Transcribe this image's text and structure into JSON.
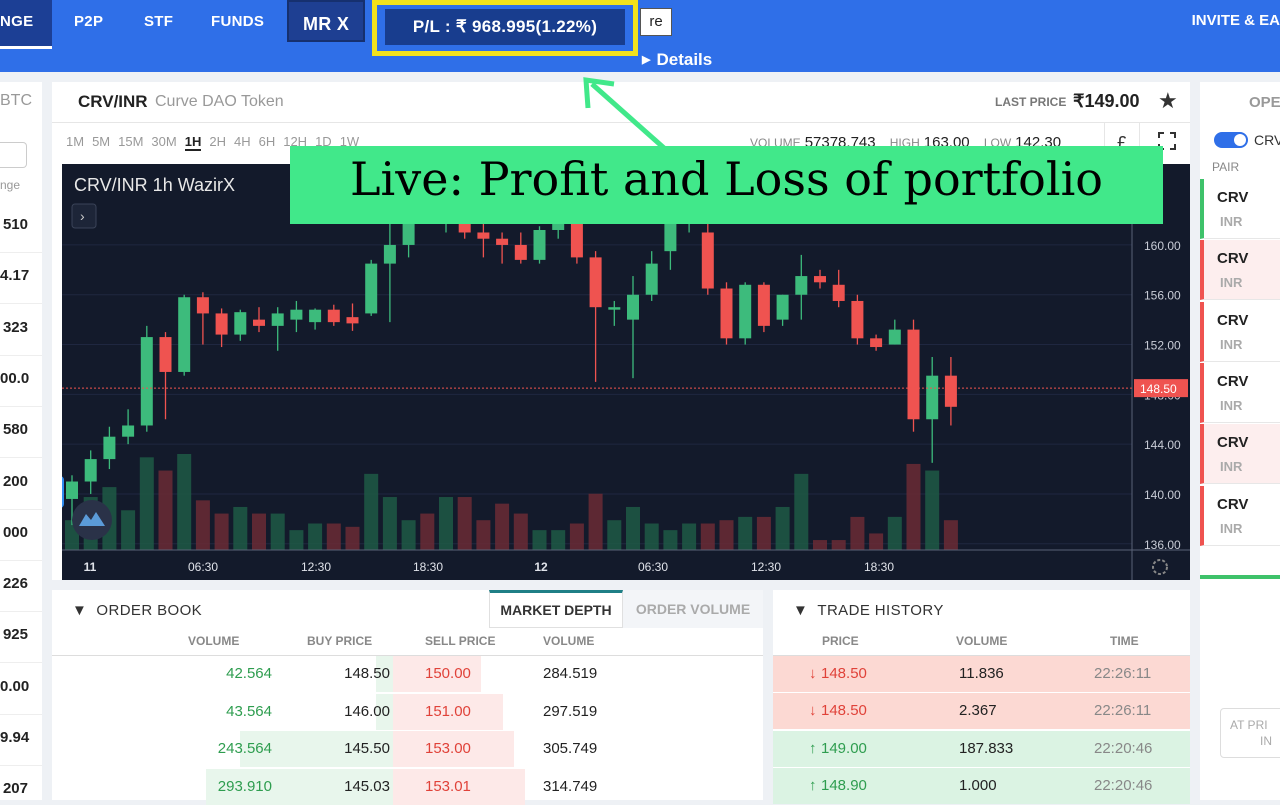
{
  "nav": {
    "exchange_label": "NGE",
    "p2p_label": "P2P",
    "stf_label": "STF",
    "funds_label": "FUNDS",
    "user_label": "MR X",
    "pl_text": "P/L : ₹ 968.995(1.22%)",
    "re_label": "re",
    "details_label": "Details",
    "invite_label": "INVITE & EA"
  },
  "markets": {
    "header": "BTC",
    "sub_label": "nge",
    "values": [
      "510",
      "4.17",
      "323",
      "00.0",
      "580",
      "200",
      "000",
      "226",
      "925",
      "0.00",
      "9.94",
      "207"
    ]
  },
  "chart_header": {
    "pair": "CRV/INR",
    "pair_name": "Curve DAO Token",
    "last_price_label": "LAST PRICE",
    "last_price": "₹149.00",
    "timeframes": [
      "1M",
      "5M",
      "15M",
      "30M",
      "1H",
      "2H",
      "4H",
      "6H",
      "12H",
      "1D",
      "1W"
    ],
    "active_timeframe": "1H",
    "volume_label": "VOLUME",
    "volume": "57378.743",
    "high_label": "HIGH",
    "high": "163.00",
    "low_label": "LOW",
    "low": "142.30",
    "currency_symbol": "£"
  },
  "chart_data": {
    "type": "candlestick",
    "title": "CRV/INR  1h  WazirX",
    "ylim": [
      135.5,
      166.5
    ],
    "y_ticks": [
      "160.00",
      "156.00",
      "152.00",
      "148.00",
      "144.00",
      "140.00",
      "136.00"
    ],
    "current_price_label": "148.50",
    "current_price": 148.5,
    "x_labels": [
      "11",
      "06:30",
      "12:30",
      "18:30",
      "12",
      "06:30",
      "12:30",
      "18:30"
    ],
    "candles": [
      {
        "o": 139.6,
        "h": 141.5,
        "l": 137.5,
        "c": 141.0,
        "v": 0.9
      },
      {
        "o": 141.0,
        "h": 143.5,
        "l": 140.0,
        "c": 142.8,
        "v": 1.6
      },
      {
        "o": 142.8,
        "h": 145.4,
        "l": 142.0,
        "c": 144.6,
        "v": 1.9
      },
      {
        "o": 144.6,
        "h": 146.8,
        "l": 144.0,
        "c": 145.5,
        "v": 1.2
      },
      {
        "o": 145.5,
        "h": 153.5,
        "l": 145.0,
        "c": 152.6,
        "v": 2.8
      },
      {
        "o": 152.6,
        "h": 153.0,
        "l": 146.0,
        "c": 149.8,
        "v": 2.4
      },
      {
        "o": 149.8,
        "h": 156.0,
        "l": 149.5,
        "c": 155.8,
        "v": 2.9
      },
      {
        "o": 155.8,
        "h": 156.2,
        "l": 152.0,
        "c": 154.5,
        "v": 1.5
      },
      {
        "o": 154.5,
        "h": 154.9,
        "l": 151.8,
        "c": 152.8,
        "v": 1.1
      },
      {
        "o": 152.8,
        "h": 154.8,
        "l": 152.3,
        "c": 154.6,
        "v": 1.3
      },
      {
        "o": 154.0,
        "h": 155.0,
        "l": 153.0,
        "c": 153.5,
        "v": 1.1
      },
      {
        "o": 153.5,
        "h": 155.0,
        "l": 151.5,
        "c": 154.5,
        "v": 1.1
      },
      {
        "o": 154.0,
        "h": 155.5,
        "l": 153.0,
        "c": 154.8,
        "v": 0.6
      },
      {
        "o": 153.8,
        "h": 154.9,
        "l": 153.2,
        "c": 154.8,
        "v": 0.8
      },
      {
        "o": 154.8,
        "h": 155.2,
        "l": 153.5,
        "c": 153.8,
        "v": 0.8
      },
      {
        "o": 154.2,
        "h": 155.3,
        "l": 153.1,
        "c": 153.7,
        "v": 0.7
      },
      {
        "o": 154.5,
        "h": 158.8,
        "l": 154.3,
        "c": 158.5,
        "v": 2.3
      },
      {
        "o": 158.5,
        "h": 162.0,
        "l": 153.8,
        "c": 160.0,
        "v": 1.6
      },
      {
        "o": 160.0,
        "h": 165.0,
        "l": 159.0,
        "c": 163.0,
        "v": 0.9
      },
      {
        "o": 163.0,
        "h": 164.0,
        "l": 162.0,
        "c": 162.5,
        "v": 1.1
      },
      {
        "o": 162.5,
        "h": 164.5,
        "l": 161.0,
        "c": 163.5,
        "v": 1.6
      },
      {
        "o": 163.0,
        "h": 164.0,
        "l": 160.5,
        "c": 161.0,
        "v": 1.6
      },
      {
        "o": 161.0,
        "h": 162.5,
        "l": 159.0,
        "c": 160.5,
        "v": 0.9
      },
      {
        "o": 160.5,
        "h": 161.0,
        "l": 158.5,
        "c": 160.0,
        "v": 1.4
      },
      {
        "o": 160.0,
        "h": 161.0,
        "l": 158.5,
        "c": 158.8,
        "v": 1.1
      },
      {
        "o": 158.8,
        "h": 161.5,
        "l": 158.5,
        "c": 161.2,
        "v": 0.6
      },
      {
        "o": 161.2,
        "h": 163.0,
        "l": 160.5,
        "c": 161.8,
        "v": 0.6
      },
      {
        "o": 161.8,
        "h": 162.2,
        "l": 158.5,
        "c": 159.0,
        "v": 0.8
      },
      {
        "o": 159.0,
        "h": 159.5,
        "l": 149.0,
        "c": 155.0,
        "v": 1.7
      },
      {
        "o": 154.8,
        "h": 155.5,
        "l": 153.5,
        "c": 155.0,
        "v": 0.9
      },
      {
        "o": 154.0,
        "h": 157.5,
        "l": 149.3,
        "c": 156.0,
        "v": 1.3
      },
      {
        "o": 156.0,
        "h": 159.5,
        "l": 155.5,
        "c": 158.5,
        "v": 0.8
      },
      {
        "o": 159.5,
        "h": 164.0,
        "l": 158.0,
        "c": 162.0,
        "v": 0.6
      },
      {
        "o": 162.0,
        "h": 163.5,
        "l": 161.0,
        "c": 162.8,
        "v": 0.8
      },
      {
        "o": 161.0,
        "h": 162.0,
        "l": 156.0,
        "c": 156.5,
        "v": 0.8
      },
      {
        "o": 156.5,
        "h": 157.0,
        "l": 152.0,
        "c": 152.5,
        "v": 0.9
      },
      {
        "o": 152.5,
        "h": 157.0,
        "l": 152.0,
        "c": 156.8,
        "v": 1.0
      },
      {
        "o": 156.8,
        "h": 157.0,
        "l": 153.0,
        "c": 153.5,
        "v": 1.0
      },
      {
        "o": 154.0,
        "h": 156.0,
        "l": 153.5,
        "c": 156.0,
        "v": 1.3
      },
      {
        "o": 156.0,
        "h": 159.2,
        "l": 154.0,
        "c": 157.5,
        "v": 2.3
      },
      {
        "o": 157.5,
        "h": 158.0,
        "l": 156.5,
        "c": 157.0,
        "v": 0.3
      },
      {
        "o": 156.8,
        "h": 158.0,
        "l": 155.0,
        "c": 155.5,
        "v": 0.3
      },
      {
        "o": 155.5,
        "h": 156.0,
        "l": 152.0,
        "c": 152.5,
        "v": 1.0
      },
      {
        "o": 152.5,
        "h": 152.8,
        "l": 151.5,
        "c": 151.8,
        "v": 0.5
      },
      {
        "o": 152.0,
        "h": 154.0,
        "l": 152.0,
        "c": 153.2,
        "v": 1.0
      },
      {
        "o": 153.2,
        "h": 154.0,
        "l": 145.0,
        "c": 146.0,
        "v": 2.6
      },
      {
        "o": 146.0,
        "h": 151.0,
        "l": 142.5,
        "c": 149.5,
        "v": 2.4
      },
      {
        "o": 149.5,
        "h": 151.0,
        "l": 145.5,
        "c": 147.0,
        "v": 0.9
      }
    ]
  },
  "order_book": {
    "title": "ORDER BOOK",
    "tab_depth": "MARKET DEPTH",
    "tab_volume": "ORDER VOLUME",
    "headers": [
      "VOLUME",
      "BUY PRICE",
      "SELL PRICE",
      "VOLUME"
    ],
    "rows": [
      {
        "buy_vol": "42.564",
        "buy_price": "148.50",
        "sell_price": "150.00",
        "sell_vol": "284.519",
        "buy_depth": 0.05,
        "sell_depth": 0.08
      },
      {
        "buy_vol": "43.564",
        "buy_price": "146.00",
        "sell_price": "151.00",
        "sell_vol": "297.519",
        "buy_depth": 0.05,
        "sell_depth": 0.1
      },
      {
        "buy_vol": "243.564",
        "buy_price": "145.50",
        "sell_price": "153.00",
        "sell_vol": "305.749",
        "buy_depth": 0.45,
        "sell_depth": 0.11
      },
      {
        "buy_vol": "293.910",
        "buy_price": "145.03",
        "sell_price": "153.01",
        "sell_vol": "314.749",
        "buy_depth": 0.55,
        "sell_depth": 0.12
      }
    ]
  },
  "trade_history": {
    "title": "TRADE HISTORY",
    "headers": [
      "PRICE",
      "VOLUME",
      "TIME"
    ],
    "rows": [
      {
        "side": "sell",
        "arrow": "↓",
        "price": "148.50",
        "volume": "11.836",
        "time": "22:26:11"
      },
      {
        "side": "sell",
        "arrow": "↓",
        "price": "148.50",
        "volume": "2.367",
        "time": "22:26:11"
      },
      {
        "side": "buy",
        "arrow": "↑",
        "price": "149.00",
        "volume": "187.833",
        "time": "22:20:46"
      },
      {
        "side": "buy",
        "arrow": "↑",
        "price": "148.90",
        "volume": "1.000",
        "time": "22:20:46"
      }
    ]
  },
  "open_orders": {
    "title": "OPE",
    "filter_symbol": "CRV",
    "pair_label": "PAIR",
    "rows": [
      {
        "sym": "CRV",
        "quote": "INR",
        "side": "buy"
      },
      {
        "sym": "CRV",
        "quote": "INR",
        "side": "sell-filled"
      },
      {
        "sym": "CRV",
        "quote": "INR",
        "side": "sell"
      },
      {
        "sym": "CRV",
        "quote": "INR",
        "side": "sell"
      },
      {
        "sym": "CRV",
        "quote": "INR",
        "side": "sell-filled"
      },
      {
        "sym": "CRV",
        "quote": "INR",
        "side": "sell"
      }
    ],
    "at_price_label": "AT PRI",
    "at_price_sub": "IN"
  },
  "annotation": {
    "text": "Live: Profit and Loss of portfolio"
  },
  "colors": {
    "nav_blue": "#2f6fe8",
    "highlight_yellow": "#f2e21d",
    "annotation_green": "#41e88a",
    "candle_up": "#3dbb7c",
    "candle_down": "#ef5350",
    "chart_bg": "#131a2b"
  }
}
